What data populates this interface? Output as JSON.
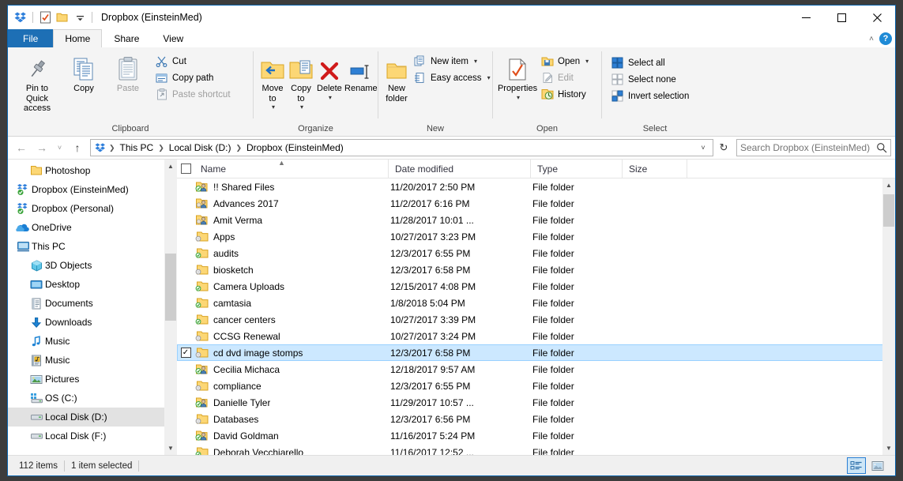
{
  "window": {
    "title": "Dropbox (EinsteinMed)",
    "quick_access": [
      "dropbox-icon",
      "properties-icon",
      "new-folder-icon",
      "customize-caret"
    ],
    "controls": {
      "minimize": "—",
      "maximize": "☐",
      "close": "✕"
    },
    "ribbon_collapse": "˄",
    "help": "?"
  },
  "tabs": [
    {
      "label": "File",
      "state": "file"
    },
    {
      "label": "Home",
      "state": "active"
    },
    {
      "label": "Share",
      "state": "normal"
    },
    {
      "label": "View",
      "state": "normal"
    }
  ],
  "ribbon": {
    "groups": [
      {
        "label": "Clipboard",
        "big": [
          {
            "label": "Pin to Quick access",
            "icon": "pin-icon",
            "disabled": false
          },
          {
            "label": "Copy",
            "icon": "copy-icon",
            "disabled": false
          },
          {
            "label": "Paste",
            "icon": "paste-icon",
            "disabled": true
          }
        ],
        "small": [
          {
            "label": "Cut",
            "icon": "scissors-icon",
            "disabled": false
          },
          {
            "label": "Copy path",
            "icon": "copy-path-icon",
            "disabled": false
          },
          {
            "label": "Paste shortcut",
            "icon": "paste-shortcut-icon",
            "disabled": true
          }
        ]
      },
      {
        "label": "Organize",
        "big": [
          {
            "label": "Move to",
            "icon": "move-to-icon",
            "caret": true
          },
          {
            "label": "Copy to",
            "icon": "copy-to-icon",
            "caret": true
          },
          {
            "label": "Delete",
            "icon": "delete-icon",
            "caret": true
          },
          {
            "label": "Rename",
            "icon": "rename-icon",
            "caret": false
          }
        ]
      },
      {
        "label": "New",
        "big": [
          {
            "label": "New folder",
            "icon": "new-folder-icon",
            "caret": false
          }
        ],
        "small": [
          {
            "label": "New item",
            "icon": "new-item-icon",
            "caret": true
          },
          {
            "label": "Easy access",
            "icon": "easy-access-icon",
            "caret": true
          }
        ]
      },
      {
        "label": "Open",
        "big": [
          {
            "label": "Properties",
            "icon": "properties-icon",
            "caret": true
          }
        ],
        "small": [
          {
            "label": "Open",
            "icon": "open-icon",
            "caret": true,
            "disabled": false
          },
          {
            "label": "Edit",
            "icon": "edit-icon",
            "caret": false,
            "disabled": true
          },
          {
            "label": "History",
            "icon": "history-icon",
            "caret": false,
            "disabled": false
          }
        ]
      },
      {
        "label": "Select",
        "small": [
          {
            "label": "Select all",
            "icon": "select-all-icon"
          },
          {
            "label": "Select none",
            "icon": "select-none-icon"
          },
          {
            "label": "Invert selection",
            "icon": "invert-selection-icon"
          }
        ]
      }
    ]
  },
  "navbar": {
    "back": "←",
    "forward": "→",
    "recent": "˅",
    "up": "↑",
    "breadcrumbs": [
      "This PC",
      "Local Disk (D:)",
      "Dropbox (EinsteinMed)"
    ],
    "dropdown": "˅",
    "refresh": "↻",
    "search_placeholder": "Search Dropbox (EinsteinMed)",
    "search_value": ""
  },
  "sidebar": {
    "items": [
      {
        "label": "Photoshop",
        "icon": "folder-icon",
        "indent": 1,
        "selected": false
      },
      {
        "label": "Dropbox (EinsteinMed)",
        "icon": "dropbox-sync-icon",
        "indent": 0,
        "selected": false
      },
      {
        "label": "Dropbox (Personal)",
        "icon": "dropbox-sync-icon",
        "indent": 0,
        "selected": false
      },
      {
        "label": "OneDrive",
        "icon": "onedrive-icon",
        "indent": 0,
        "selected": false
      },
      {
        "label": "This PC",
        "icon": "this-pc-icon",
        "indent": 0,
        "selected": false
      },
      {
        "label": "3D Objects",
        "icon": "3d-objects-icon",
        "indent": 1,
        "selected": false
      },
      {
        "label": "Desktop",
        "icon": "desktop-icon",
        "indent": 1,
        "selected": false
      },
      {
        "label": "Documents",
        "icon": "documents-icon",
        "indent": 1,
        "selected": false
      },
      {
        "label": "Downloads",
        "icon": "downloads-icon",
        "indent": 1,
        "selected": false
      },
      {
        "label": "Music",
        "icon": "music-note-icon",
        "indent": 1,
        "selected": false
      },
      {
        "label": "Music",
        "icon": "music-library-icon",
        "indent": 1,
        "selected": false
      },
      {
        "label": "Pictures",
        "icon": "pictures-icon",
        "indent": 1,
        "selected": false
      },
      {
        "label": "OS (C:)",
        "icon": "os-drive-icon",
        "indent": 1,
        "selected": false
      },
      {
        "label": "Local Disk (D:)",
        "icon": "drive-icon",
        "indent": 1,
        "selected": true
      },
      {
        "label": "Local Disk (F:)",
        "icon": "drive-icon",
        "indent": 1,
        "selected": false
      }
    ]
  },
  "filelist": {
    "columns": [
      "Name",
      "Date modified",
      "Type",
      "Size"
    ],
    "sort_column": "Name",
    "sort_direction": "ascending",
    "rows": [
      {
        "name": "!! Shared Files",
        "date": "11/20/2017 2:50 PM",
        "type": "File folder",
        "size": "",
        "icon": "shared-folder-icon",
        "selected": false
      },
      {
        "name": "Advances 2017",
        "date": "11/2/2017 6:16 PM",
        "type": "File folder",
        "size": "",
        "icon": "shared-folder-icon",
        "selected": false
      },
      {
        "name": "Amit Verma",
        "date": "11/28/2017 10:01 ...",
        "type": "File folder",
        "size": "",
        "icon": "shared-folder-icon",
        "selected": false
      },
      {
        "name": "Apps",
        "date": "10/27/2017 3:23 PM",
        "type": "File folder",
        "size": "",
        "icon": "sync-pending-folder-icon",
        "selected": false
      },
      {
        "name": "audits",
        "date": "12/3/2017 6:55 PM",
        "type": "File folder",
        "size": "",
        "icon": "synced-folder-icon",
        "selected": false
      },
      {
        "name": "biosketch",
        "date": "12/3/2017 6:58 PM",
        "type": "File folder",
        "size": "",
        "icon": "sync-pending-folder-icon",
        "selected": false
      },
      {
        "name": "Camera Uploads",
        "date": "12/15/2017 4:08 PM",
        "type": "File folder",
        "size": "",
        "icon": "synced-folder-icon",
        "selected": false
      },
      {
        "name": "camtasia",
        "date": "1/8/2018 5:04 PM",
        "type": "File folder",
        "size": "",
        "icon": "synced-folder-icon",
        "selected": false
      },
      {
        "name": "cancer centers",
        "date": "10/27/2017 3:39 PM",
        "type": "File folder",
        "size": "",
        "icon": "synced-folder-icon",
        "selected": false
      },
      {
        "name": "CCSG Renewal",
        "date": "10/27/2017 3:24 PM",
        "type": "File folder",
        "size": "",
        "icon": "sync-pending-folder-icon",
        "selected": false
      },
      {
        "name": "cd dvd image stomps",
        "date": "12/3/2017 6:58 PM",
        "type": "File folder",
        "size": "",
        "icon": "sync-pending-folder-icon",
        "selected": true
      },
      {
        "name": "Cecilia Michaca",
        "date": "12/18/2017 9:57 AM",
        "type": "File folder",
        "size": "",
        "icon": "shared-folder-icon",
        "selected": false
      },
      {
        "name": "compliance",
        "date": "12/3/2017 6:55 PM",
        "type": "File folder",
        "size": "",
        "icon": "sync-pending-folder-icon",
        "selected": false
      },
      {
        "name": "Danielle Tyler",
        "date": "11/29/2017 10:57 ...",
        "type": "File folder",
        "size": "",
        "icon": "shared-folder-icon",
        "selected": false
      },
      {
        "name": "Databases",
        "date": "12/3/2017 6:56 PM",
        "type": "File folder",
        "size": "",
        "icon": "sync-pending-folder-icon",
        "selected": false
      },
      {
        "name": "David Goldman",
        "date": "11/16/2017 5:24 PM",
        "type": "File folder",
        "size": "",
        "icon": "shared-folder-icon",
        "selected": false
      },
      {
        "name": "Deborah Vecchiarello",
        "date": "11/16/2017 12:52 ...",
        "type": "File folder",
        "size": "",
        "icon": "synced-folder-icon",
        "selected": false
      }
    ]
  },
  "statusbar": {
    "item_count": "112 items",
    "selection": "1 item selected",
    "views": [
      {
        "name": "details-view",
        "active": true
      },
      {
        "name": "large-icons-view",
        "active": false
      }
    ]
  },
  "colors": {
    "accent": "#0a64ad",
    "file_tab": "#1d6fb5",
    "selection": "#cce8ff",
    "folder_yellow": "#fcd775",
    "dropbox_blue": "#1e7fd4"
  }
}
